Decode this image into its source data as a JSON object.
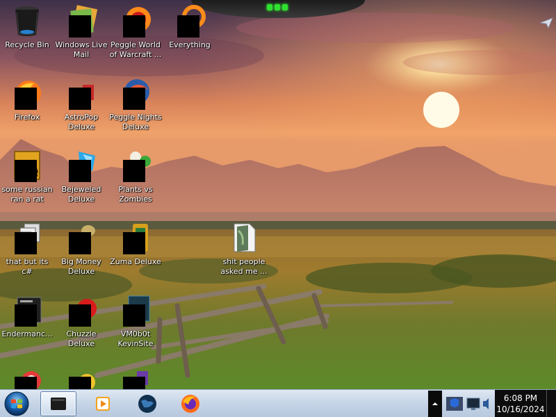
{
  "desktop": {
    "icons": [
      {
        "label": "Recycle Bin",
        "icon": "recycle-bin-icon",
        "redacted": false
      },
      {
        "label": "Windows Live Mail",
        "icon": "mail-icon",
        "redacted": true
      },
      {
        "label": "Peggle World of Warcraft ...",
        "icon": "peggle-wow-icon",
        "redacted": true
      },
      {
        "label": "Everything",
        "icon": "everything-icon",
        "redacted": true
      },
      {
        "label": "Firefox",
        "icon": "firefox-icon",
        "redacted": true
      },
      {
        "label": "AstroPop Deluxe",
        "icon": "astropop-icon",
        "redacted": true
      },
      {
        "label": "Peggle Nights Deluxe",
        "icon": "peggle-nights-icon",
        "redacted": true
      },
      {
        "label": "some russian ran a rat",
        "icon": "notepad-icon",
        "redacted": true
      },
      {
        "label": "Bejeweled Deluxe",
        "icon": "bejeweled-icon",
        "redacted": true
      },
      {
        "label": "Plants vs Zombies",
        "icon": "plants-vs-zombies-icon",
        "redacted": true
      },
      {
        "label": "that but its c#",
        "icon": "files-icon",
        "redacted": true
      },
      {
        "label": "Big Money Deluxe",
        "icon": "big-money-icon",
        "redacted": true
      },
      {
        "label": "Zuma Deluxe",
        "icon": "zuma-icon",
        "redacted": true
      },
      {
        "label": "shit people asked me ...",
        "icon": "document-icon",
        "redacted": false
      },
      {
        "label": "Endermanc...",
        "icon": "terminal-icon",
        "redacted": true
      },
      {
        "label": "Chuzzle Deluxe",
        "icon": "chuzzle-icon",
        "redacted": true
      },
      {
        "label": "VM0b0t KevinSite",
        "icon": "site-icon",
        "redacted": true
      },
      {
        "label": "",
        "icon": "game-icon",
        "redacted": true
      },
      {
        "label": "",
        "icon": "game-icon",
        "redacted": true
      },
      {
        "label": "",
        "icon": "game-icon",
        "redacted": true
      }
    ]
  },
  "taskbar": {
    "pinned": [
      {
        "name": "terminal-app",
        "icon": "terminal-icon",
        "active": true
      },
      {
        "name": "media-player",
        "icon": "media-player-icon",
        "active": false
      },
      {
        "name": "browser-globe",
        "icon": "globe-icon",
        "active": false
      },
      {
        "name": "firefox",
        "icon": "firefox-icon",
        "active": false
      }
    ],
    "clock": {
      "time": "6:08 PM",
      "date": "10/16/2024"
    }
  },
  "colors": {
    "taskbar": "#c6d4e6",
    "notch_light": "#2fe02f",
    "sky_top": "#4a3050",
    "sun": "#fff6c8"
  }
}
